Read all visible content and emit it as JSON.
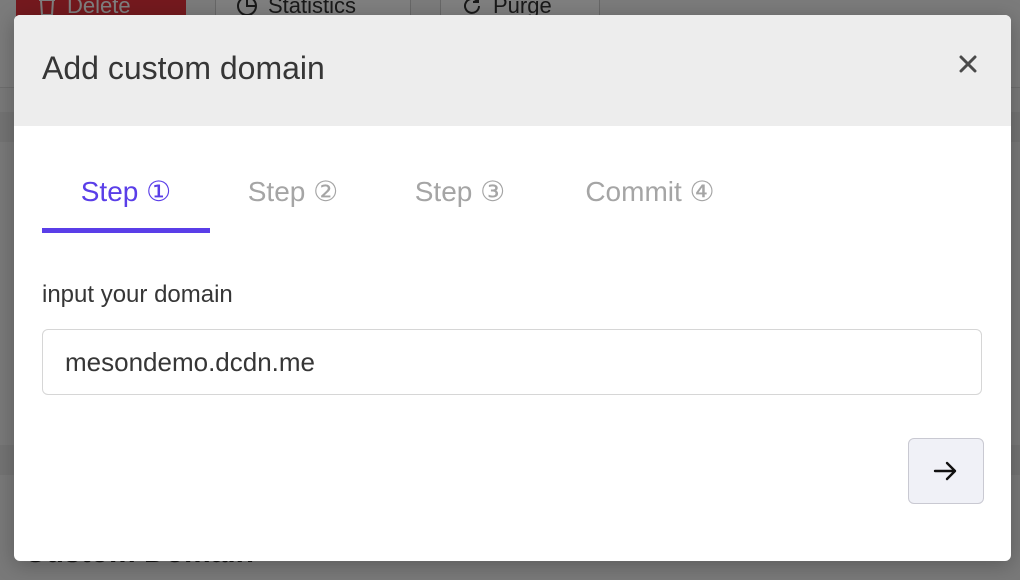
{
  "background": {
    "toolbar_buttons": {
      "delete": "Delete",
      "statistics": "Statistics",
      "purge": "Purge"
    },
    "section_heading": "Custom Domain"
  },
  "modal": {
    "title": "Add custom domain",
    "close_icon": "close-icon",
    "tabs": [
      {
        "label": "Step ①",
        "active": true
      },
      {
        "label": "Step ②",
        "active": false
      },
      {
        "label": "Step ③",
        "active": false
      },
      {
        "label": "Commit ④",
        "active": false
      }
    ],
    "field_label": "input your domain",
    "domain_value": "mesondemo.dcdn.me",
    "next_icon": "arrow-right-icon"
  },
  "colors": {
    "accent": "#5a3ee8",
    "inactive_tab": "#a5a5a5",
    "header_bg": "#ededed",
    "delete_red": "#e8323c"
  }
}
